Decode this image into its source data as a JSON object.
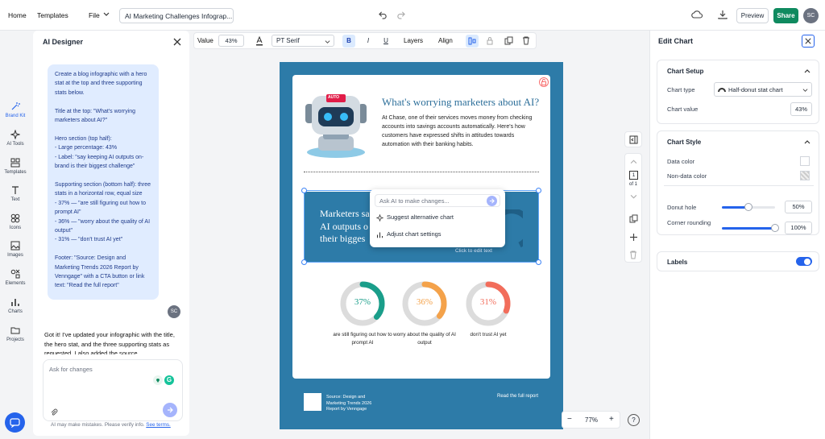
{
  "topbar": {
    "home": "Home",
    "templates": "Templates",
    "file": "File",
    "doc_title": "AI Marketing Challenges Infograp...",
    "preview": "Preview",
    "share": "Share",
    "user_initials": "SC"
  },
  "rail": [
    {
      "label": "Brand Kit",
      "icon": "magic-wand-icon"
    },
    {
      "label": "AI Tools",
      "icon": "sparkle-icon"
    },
    {
      "label": "Templates",
      "icon": "templates-icon"
    },
    {
      "label": "Text",
      "icon": "text-icon"
    },
    {
      "label": "Icons",
      "icon": "icons-icon"
    },
    {
      "label": "Images",
      "icon": "image-icon"
    },
    {
      "label": "Elements",
      "icon": "elements-icon"
    },
    {
      "label": "Charts",
      "icon": "chart-icon"
    },
    {
      "label": "Projects",
      "icon": "folder-icon"
    }
  ],
  "ai_panel": {
    "title": "AI Designer",
    "user_message": "Create a blog infographic with a hero stat at the top and three supporting stats below.\n\nTitle at the top: \"What's worrying marketers about AI?\"\n\nHero section (top half):\n- Large percentage: 43%\n- Label: \"say keeping AI outputs on-brand is their biggest challenge\"\n\nSupporting section (bottom half): three stats in a horizontal row, equal size\n- 37% — \"are still figuring out how to prompt AI\"\n- 36% — \"worry about the quality of AI output\"\n- 31% — \"don't trust AI yet\"\n\nFooter: \"Source: Design and Marketing Trends 2026 Report by Venngage\" with a CTA button or link text: \"Read the full report\"",
    "user_initials": "SC",
    "ai_reply": "Got it! I've updated your infographic with the title, the hero stat, and the three supporting stats as requested. I also added the source",
    "input_placeholder": "Ask for changes",
    "disclaimer": "AI may make mistakes. Please verify info.",
    "terms_link": "See terms."
  },
  "toolbar": {
    "value_label": "Value",
    "value": "43%",
    "font": "PT Serif",
    "bold": "B",
    "italic": "I",
    "underline": "U",
    "layers": "Layers",
    "align": "Align"
  },
  "canvas": {
    "robot_badge": "AUTO",
    "headline": "What's worrying marketers about AI?",
    "body": "At Chase, one of their services moves money from checking accounts into savings accounts automatically. Here's how customers have expressed shifts in attitudes towards automation with their banking habits.",
    "hero_text": "Marketers say keeping AI outputs on-brand is their biggest challenge",
    "hero_visible": "Marketers sa\nAI outputs o\ntheir bigges",
    "click_to_edit": "Click to edit text",
    "ai_popup": {
      "placeholder": "Ask AI to make changes...",
      "option1": "Suggest alternative chart",
      "option2": "Adjust chart settings"
    },
    "stats": [
      {
        "value": "37%",
        "label": "are still figuring out how to prompt AI",
        "color": "#1a9e8a",
        "fraction": 0.37
      },
      {
        "value": "36%",
        "label": "worry about the quality of AI output",
        "color": "#f4a24a",
        "fraction": 0.36
      },
      {
        "value": "31%",
        "label": "don't trust AI yet",
        "color": "#f26d5b",
        "fraction": 0.31
      }
    ],
    "footer_source": "Source: Design and Marketing Trends 2026 Report by Venngage",
    "footer_cta": "Read the full report"
  },
  "side_tools": {
    "page_num": "1",
    "page_of": "of 1"
  },
  "zoom": {
    "minus": "−",
    "value": "77%",
    "plus": "+",
    "help": "?"
  },
  "edit_panel": {
    "title": "Edit Chart",
    "setup_title": "Chart Setup",
    "chart_type_label": "Chart type",
    "chart_type_value": "Half-donut stat chart",
    "chart_value_label": "Chart value",
    "chart_value": "43%",
    "style_title": "Chart Style",
    "data_color_label": "Data color",
    "nondata_color_label": "Non-data color",
    "donut_hole_label": "Donut hole",
    "donut_hole_value": "50%",
    "donut_hole_level": 0.5,
    "corner_label": "Corner rounding",
    "corner_value": "100%",
    "corner_level": 1.0,
    "labels_title": "Labels",
    "labels_on": true
  },
  "colors": {
    "accent": "#2563eb",
    "page_bg": "#2d7ba8",
    "share": "#0f8a5f",
    "headline": "#2d6f9a"
  }
}
